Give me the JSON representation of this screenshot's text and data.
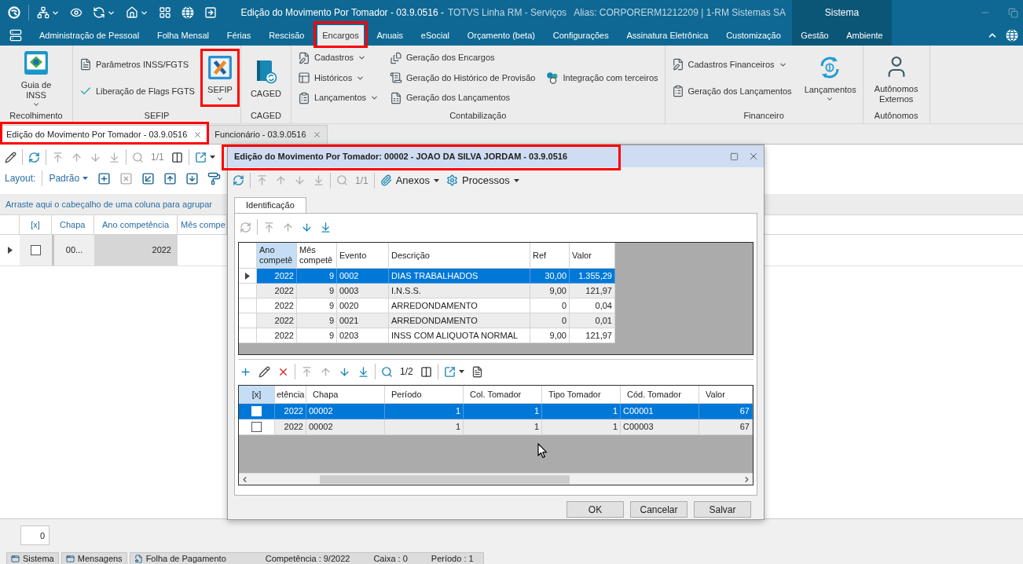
{
  "title_bar": {
    "title": "Edição do Movimento Por Tomador - 03.9.0516 -",
    "app": "TOTVS Linha RM - Serviços",
    "alias": "Alias: CORPORERM1212209 | 1-RM Sistemas SA",
    "context_label": "Sistema"
  },
  "menu_tabs": [
    {
      "label": "Administração de Pessoal",
      "selected": false,
      "kind": "standard",
      "annotated": false
    },
    {
      "label": "Folha Mensal",
      "selected": false,
      "kind": "standard",
      "annotated": false
    },
    {
      "label": "Férias",
      "selected": false,
      "kind": "standard",
      "annotated": false
    },
    {
      "label": "Rescisão",
      "selected": false,
      "kind": "standard",
      "annotated": false
    },
    {
      "label": "Encargos",
      "selected": true,
      "kind": "standard",
      "annotated": true
    },
    {
      "label": "Anuais",
      "selected": false,
      "kind": "standard",
      "annotated": false
    },
    {
      "label": "eSocial",
      "selected": false,
      "kind": "standard",
      "annotated": false
    },
    {
      "label": "Orçamento (beta)",
      "selected": false,
      "kind": "standard",
      "annotated": false
    },
    {
      "label": "Configurações",
      "selected": false,
      "kind": "standard",
      "annotated": false
    },
    {
      "label": "Assinatura Eletrônica",
      "selected": false,
      "kind": "standard",
      "annotated": false
    },
    {
      "label": "Customização",
      "selected": false,
      "kind": "standard",
      "annotated": false
    },
    {
      "label": "Gestão",
      "selected": false,
      "kind": "context",
      "annotated": false
    },
    {
      "label": "Ambiente",
      "selected": false,
      "kind": "context",
      "annotated": false
    }
  ],
  "ribbon": [
    {
      "label": "Recolhimento",
      "columns": [
        [
          {
            "kind": "large",
            "label": "Guia de INSS",
            "dropdown": true,
            "annotated": false
          }
        ]
      ]
    },
    {
      "label": "SEFIP",
      "columns": [
        [
          {
            "kind": "small",
            "label": "Parâmetros INSS/FGTS",
            "dropdown": false,
            "annotated": false
          },
          {
            "kind": "small",
            "label": "Liberação de Flags FGTS",
            "dropdown": false,
            "annotated": false
          }
        ],
        [
          {
            "kind": "large",
            "label": "SEFIP",
            "dropdown": true,
            "annotated": true
          }
        ]
      ]
    },
    {
      "label": "CAGED",
      "columns": [
        [
          {
            "kind": "large",
            "label": "CAGED",
            "dropdown": false,
            "annotated": false
          }
        ]
      ]
    },
    {
      "label": "Contabilização",
      "columns": [
        [
          {
            "kind": "small",
            "label": "Cadastros",
            "dropdown": true,
            "annotated": false
          },
          {
            "kind": "small",
            "label": "Históricos",
            "dropdown": true,
            "annotated": false
          },
          {
            "kind": "small",
            "label": "Lançamentos",
            "dropdown": true,
            "annotated": false
          }
        ],
        [
          {
            "kind": "small",
            "label": "Geração dos Encargos",
            "dropdown": false,
            "annotated": false
          },
          {
            "kind": "small",
            "label": "Geração do Histórico de Provisão",
            "dropdown": false,
            "annotated": false
          },
          {
            "kind": "small",
            "label": "Geração dos Lançamentos",
            "dropdown": false,
            "annotated": false
          }
        ],
        [
          {
            "kind": "small",
            "label": "Integração com terceiros",
            "dropdown": false,
            "annotated": false
          }
        ]
      ]
    },
    {
      "label": "Financeiro",
      "columns": [
        [
          {
            "kind": "small",
            "label": "Cadastros Financeiros",
            "dropdown": true,
            "annotated": false
          },
          {
            "kind": "small",
            "label": "Geração dos Lançamentos",
            "dropdown": false,
            "annotated": false
          }
        ],
        [
          {
            "kind": "large",
            "label": "Lançamentos",
            "dropdown": true,
            "annotated": false
          }
        ]
      ]
    },
    {
      "label": "Autônomos",
      "columns": [
        [
          {
            "kind": "large",
            "label": "Autônomos Externos",
            "dropdown": false,
            "annotated": false
          }
        ]
      ]
    }
  ],
  "document_tabs": [
    {
      "label": "Edição do Movimento Por Tomador - 03.9.0516",
      "selected": true,
      "annotated": true
    },
    {
      "label": "Funcionário - 03.9.0516",
      "selected": false,
      "annotated": false
    }
  ],
  "main": {
    "toolbar": [
      [
        {
          "kind": "button",
          "disabled": false
        }
      ],
      [
        {
          "kind": "button",
          "disabled": false
        }
      ],
      [
        {
          "kind": "button",
          "disabled": true
        },
        {
          "kind": "button",
          "disabled": true
        },
        {
          "kind": "button",
          "disabled": true
        },
        {
          "kind": "button",
          "disabled": true
        }
      ],
      [
        {
          "kind": "button",
          "disabled": true
        },
        {
          "kind": "pager",
          "text": "1/1",
          "disabled": true
        },
        {
          "kind": "button",
          "disabled": false
        }
      ],
      [
        {
          "kind": "split",
          "disabled": false
        }
      ]
    ],
    "layout_bar": {
      "label": "Layout:",
      "value": "Padrão",
      "buttons": [
        {
          "disabled": false
        },
        {
          "disabled": true
        },
        {
          "disabled": false
        },
        {
          "disabled": false
        },
        {
          "disabled": false
        },
        {
          "disabled": false
        }
      ]
    },
    "group_hint": "Arraste aqui o cabeçalho de uma coluna para agrupar",
    "grid": {
      "columns": [
        {
          "label": "[x]"
        },
        {
          "label": "Chapa"
        },
        {
          "label": "Ano competência"
        },
        {
          "label": "Mês compe"
        }
      ],
      "rows": [
        {
          "current": true,
          "cells": [
            {
              "kind": "checkbox",
              "checked": false
            },
            {
              "kind": "text",
              "text": "00...",
              "focused": false
            },
            {
              "kind": "text",
              "text": "2022",
              "focused": true
            }
          ]
        }
      ]
    },
    "count": "0"
  },
  "dialog": {
    "title": {
      "text": "Edição do Movimento Por Tomador: 00002 - JOAO DA SILVA JORDAM - 03.9.0516",
      "annotated": true
    },
    "toolbar": [
      [
        {
          "kind": "button",
          "disabled": false
        }
      ],
      [
        {
          "kind": "button",
          "disabled": true
        },
        {
          "kind": "button",
          "disabled": true
        },
        {
          "kind": "button",
          "disabled": true
        },
        {
          "kind": "button",
          "disabled": true
        }
      ],
      [
        {
          "kind": "button",
          "disabled": true
        },
        {
          "kind": "pager",
          "text": "1/1",
          "disabled": true
        }
      ],
      [
        {
          "kind": "menu",
          "text": "Anexos",
          "disabled": false
        },
        {
          "kind": "menu",
          "text": "Processos",
          "disabled": false
        }
      ]
    ],
    "tabs": [
      {
        "label": "Identificação",
        "selected": true
      }
    ],
    "grids": [
      {
        "kind": "indicator",
        "toolbar": [
          [
            {
              "kind": "button",
              "disabled": true
            }
          ],
          [
            {
              "kind": "button",
              "disabled": true
            },
            {
              "kind": "button",
              "disabled": true
            },
            {
              "kind": "button",
              "disabled": false
            },
            {
              "kind": "button",
              "disabled": false
            }
          ]
        ],
        "columns": [
          {
            "label": "Ano competê",
            "highlighted": true
          },
          {
            "label": "Mês competê",
            "highlighted": false
          },
          {
            "label": "Evento",
            "highlighted": false
          },
          {
            "label": "Descrição",
            "highlighted": false
          },
          {
            "label": "Ref",
            "highlighted": false
          },
          {
            "label": "Valor",
            "highlighted": false
          }
        ],
        "rows": [
          {
            "selected": true,
            "cells": [
              "2022",
              "9",
              "0002",
              "DIAS TRABALHADOS",
              "30,00",
              "1.355,29"
            ]
          },
          {
            "selected": false,
            "cells": [
              "2022",
              "9",
              "0003",
              "I.N.S.S.",
              "9,00",
              "121,97"
            ]
          },
          {
            "selected": false,
            "cells": [
              "2022",
              "9",
              "0020",
              "ARREDONDAMENTO",
              "0",
              "0,04"
            ]
          },
          {
            "selected": false,
            "cells": [
              "2022",
              "9",
              "0021",
              "ARREDONDAMENTO",
              "0",
              "0,01"
            ]
          },
          {
            "selected": false,
            "cells": [
              "2022",
              "9",
              "0203",
              "INSS COM ALIQUOTA NORMAL",
              "9,00",
              "121,97"
            ]
          }
        ]
      },
      {
        "kind": "checkbox",
        "toolbar": [
          [
            {
              "kind": "button",
              "disabled": false
            },
            {
              "kind": "button",
              "disabled": false
            },
            {
              "kind": "button",
              "disabled": false
            }
          ],
          [
            {
              "kind": "button",
              "disabled": true
            },
            {
              "kind": "button",
              "disabled": true
            },
            {
              "kind": "button",
              "disabled": false
            },
            {
              "kind": "button",
              "disabled": false
            }
          ],
          [
            {
              "kind": "button",
              "disabled": false
            },
            {
              "kind": "pager",
              "text": "1/2",
              "disabled": false
            },
            {
              "kind": "button",
              "disabled": false
            }
          ],
          [
            {
              "kind": "split",
              "disabled": false
            },
            {
              "kind": "button",
              "disabled": false
            }
          ]
        ],
        "columns": [
          {
            "label": "[x]",
            "highlighted": true
          },
          {
            "label": "etência",
            "highlighted": false
          },
          {
            "label": "Chapa",
            "highlighted": false
          },
          {
            "label": "Período",
            "highlighted": false
          },
          {
            "label": "Col. Tomador",
            "highlighted": false
          },
          {
            "label": "Tipo Tomador",
            "highlighted": false
          },
          {
            "label": "Cód. Tomador",
            "highlighted": false
          },
          {
            "label": "Valor",
            "highlighted": false
          }
        ],
        "rows": [
          {
            "selected": true,
            "cells": [
              {
                "kind": "checkbox",
                "checked": false
              },
              {
                "kind": "text",
                "text": "2022"
              },
              {
                "kind": "text",
                "text": "00002"
              },
              {
                "kind": "text",
                "text": "1"
              },
              {
                "kind": "text",
                "text": "1"
              },
              {
                "kind": "text",
                "text": "1"
              },
              {
                "kind": "text",
                "text": "C00001"
              },
              {
                "kind": "text",
                "text": "67"
              }
            ]
          },
          {
            "selected": false,
            "cells": [
              {
                "kind": "checkbox",
                "checked": false
              },
              {
                "kind": "text",
                "text": "2022"
              },
              {
                "kind": "text",
                "text": "00002"
              },
              {
                "kind": "text",
                "text": "1"
              },
              {
                "kind": "text",
                "text": "1"
              },
              {
                "kind": "text",
                "text": "1"
              },
              {
                "kind": "text",
                "text": "C00003"
              },
              {
                "kind": "text",
                "text": "67"
              }
            ]
          }
        ]
      }
    ],
    "buttons": [
      {
        "label": "OK"
      },
      {
        "label": "Cancelar"
      },
      {
        "label": "Salvar"
      }
    ]
  },
  "status_bar": {
    "tabs": [
      {
        "label": "Sistema"
      },
      {
        "label": "Mensagens"
      }
    ],
    "module": "Folha de Pagamento",
    "fields": [
      "Competência : 9/2022",
      "Caixa : 0",
      "Período : 1"
    ]
  }
}
